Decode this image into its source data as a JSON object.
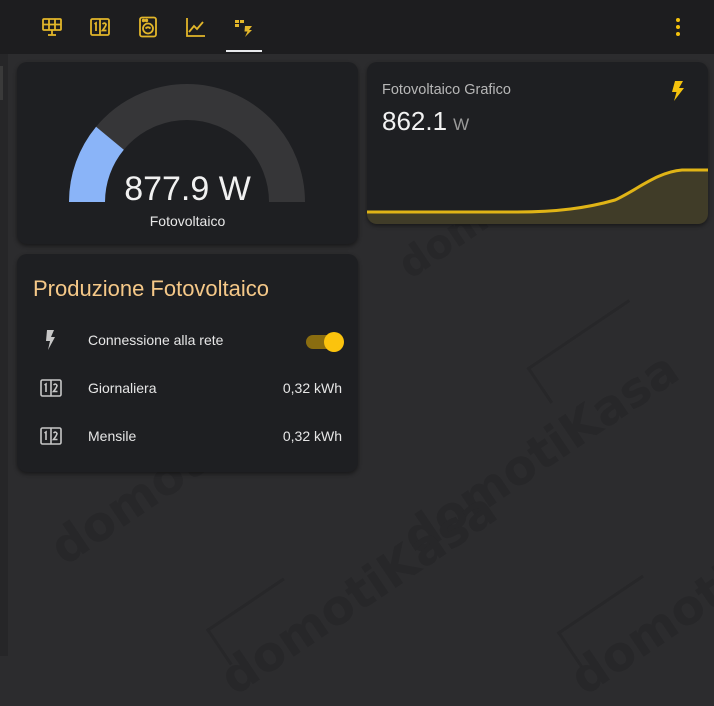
{
  "topbar": {
    "tabs": [
      {
        "icon": "solar-panel-icon",
        "active": false
      },
      {
        "icon": "counter-icon",
        "active": false
      },
      {
        "icon": "washing-machine-icon",
        "active": false
      },
      {
        "icon": "chart-line-icon",
        "active": false
      },
      {
        "icon": "solar-power-icon",
        "active": true
      }
    ],
    "accent_color": "#e2b62a",
    "menu_icon": "dots-vertical-icon"
  },
  "gauge": {
    "value_text": "877.9 W",
    "name": "Fotovoltaico",
    "fill_fraction": 0.22,
    "fill_color": "#8ab4f8",
    "track_color": "#363638"
  },
  "graph": {
    "title": "Fotovoltaico Grafico",
    "value": "862.1",
    "unit": "W",
    "icon": "flash-icon",
    "line_color": "#e0b416",
    "fill_color": "#403c28"
  },
  "production": {
    "title": "Produzione Fotovoltaico",
    "rows": [
      {
        "icon": "flash-icon",
        "label": "Connessione alla rete",
        "type": "toggle",
        "state": "on"
      },
      {
        "icon": "counter-icon",
        "label": "Giornaliera",
        "value": "0,32 kWh"
      },
      {
        "icon": "counter-icon",
        "label": "Mensile",
        "value": "0,32 kWh"
      }
    ]
  },
  "watermark": {
    "text": "domotiKasa"
  }
}
